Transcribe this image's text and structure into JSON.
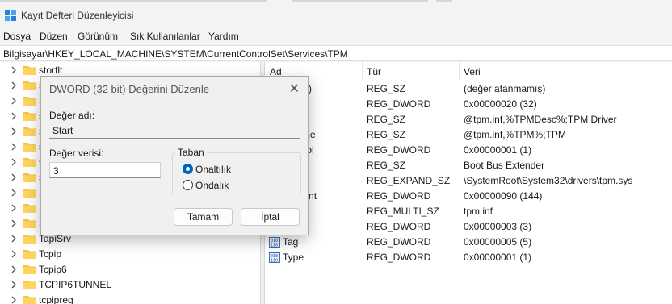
{
  "window": {
    "title": "Kayıt Defteri Düzenleyicisi",
    "icon": "registry-icon"
  },
  "menu": [
    "Dosya",
    "Düzen",
    "Görünüm",
    "Sık Kullanılanlar",
    "Yardım"
  ],
  "address": "Bilgisayar\\HKEY_LOCAL_MACHINE\\SYSTEM\\CurrentControlSet\\Services\\TPM",
  "tree": [
    {
      "label": "storflt"
    },
    {
      "label": "s"
    },
    {
      "label": "S"
    },
    {
      "label": "s"
    },
    {
      "label": "s"
    },
    {
      "label": "s"
    },
    {
      "label": "s"
    },
    {
      "label": "s"
    },
    {
      "label": "S"
    },
    {
      "label": "S"
    },
    {
      "label": "S"
    },
    {
      "label": "TapiSrv"
    },
    {
      "label": "Tcpip"
    },
    {
      "label": "Tcpip6"
    },
    {
      "label": "TCPIP6TUNNEL"
    },
    {
      "label": "tcpipreg"
    }
  ],
  "list": {
    "columns": [
      "Ad",
      "Tür",
      "Veri"
    ],
    "rows": [
      {
        "name": "ayılan)",
        "type": "REG_SZ",
        "data": "(değer atanmamış)",
        "icon": "string-value-icon"
      },
      {
        "name": "lags",
        "type": "REG_DWORD",
        "data": "0x00000020 (32)",
        "icon": "binary-value-icon"
      },
      {
        "name": "ption",
        "type": "REG_SZ",
        "data": "@tpm.inf,%TPMDesc%;TPM Driver",
        "icon": "string-value-icon"
      },
      {
        "name": "lyName",
        "type": "REG_SZ",
        "data": "@tpm.inf,%TPM%;TPM",
        "icon": "string-value-icon"
      },
      {
        "name": "Control",
        "type": "REG_DWORD",
        "data": "0x00000001 (1)",
        "icon": "binary-value-icon"
      },
      {
        "name": "",
        "type": "REG_SZ",
        "data": "Boot Bus Extender",
        "icon": "string-value-icon"
      },
      {
        "name": "ePath",
        "type": "REG_EXPAND_SZ",
        "data": "\\SystemRoot\\System32\\drivers\\tpm.sys",
        "icon": "string-value-icon"
      },
      {
        "name": "otCount",
        "type": "REG_DWORD",
        "data": "0x00000090 (144)",
        "icon": "binary-value-icon"
      },
      {
        "name": "rs",
        "type": "REG_MULTI_SZ",
        "data": "tpm.inf",
        "icon": "string-value-icon"
      },
      {
        "name": "",
        "type": "REG_DWORD",
        "data": "0x00000003 (3)",
        "icon": "binary-value-icon"
      },
      {
        "name": "Tag",
        "type": "REG_DWORD",
        "data": "0x00000005 (5)",
        "icon": "binary-value-icon"
      },
      {
        "name": "Type",
        "type": "REG_DWORD",
        "data": "0x00000001 (1)",
        "icon": "binary-value-icon"
      }
    ]
  },
  "dialog": {
    "title": "DWORD (32 bit) Değerini Düzenle",
    "name_label": "Değer adı:",
    "name_value": "Start",
    "data_label": "Değer verisi:",
    "data_value": "3",
    "base_label": "Taban",
    "base_options": [
      {
        "label": "Onaltılık",
        "selected": true
      },
      {
        "label": "Ondalık",
        "selected": false
      }
    ],
    "ok": "Tamam",
    "cancel": "İptal"
  },
  "colors": {
    "accent": "#0067c0",
    "folder": "#f6c343",
    "dialog_bg": "#f0f0f0"
  }
}
